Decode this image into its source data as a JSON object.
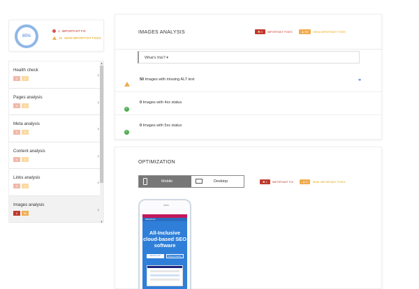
{
  "score": {
    "percent": "85%",
    "important_count": "1",
    "important_label": "IMPORTANT FIX",
    "semi_count": "15",
    "semi_label": "SEMI-IMPORTANT FIXES"
  },
  "nav": {
    "items": [
      {
        "label": "Health check",
        "red": "0",
        "yellow": "0",
        "active": false
      },
      {
        "label": "Pages analysis",
        "red": "0",
        "yellow": "0",
        "active": false
      },
      {
        "label": "Meta analysis",
        "red": "0",
        "yellow": "0",
        "active": false
      },
      {
        "label": "Content analysis",
        "red": "0",
        "yellow": "0",
        "active": false
      },
      {
        "label": "Links analysis",
        "red": "0",
        "yellow": "0",
        "active": false
      },
      {
        "label": "Images analysis",
        "red": "0",
        "yellow": "50",
        "active": true
      }
    ]
  },
  "images": {
    "title": "IMAGES ANALYSIS",
    "important_count": "0",
    "important_label": "IMPORTANT FIXES",
    "semi_count": "50",
    "semi_label": "SEMI-IMPORTANT FIXES",
    "whats_this": "What's this? ▾",
    "rows": [
      {
        "count": "50",
        "text": "Images with missing ALT text",
        "status": "warning"
      },
      {
        "count": "0",
        "text": "Images with 4xx status",
        "status": "ok"
      },
      {
        "count": "0",
        "text": "Images with 5xx status",
        "status": "ok"
      }
    ]
  },
  "optimization": {
    "title": "OPTIMIZATION",
    "mobile_label": "Mobile",
    "desktop_label": "Desktop",
    "important_count": "1",
    "important_label": "IMPORTANT FIX",
    "semi_count": "2",
    "semi_label": "SEMI-IMPORTANT FIXES",
    "preview": {
      "brand": "SEOptimer",
      "hero": "All-Inclusive cloud-based SEO software",
      "btn1": "Start free trial",
      "btn2": "Discover features"
    }
  },
  "colors": {
    "red": "#c0392b",
    "yellow": "#f0ad4e",
    "green": "#4cae4c",
    "blue": "#3a7bd5"
  }
}
